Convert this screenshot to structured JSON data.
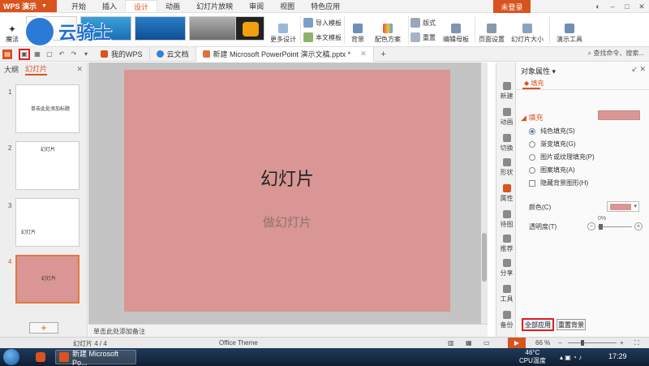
{
  "app": {
    "name": "WPS 演示",
    "login_label": "未登录",
    "accent": "#d9531e"
  },
  "menu_tabs": [
    "开始",
    "插入",
    "设计",
    "动画",
    "幻灯片放映",
    "审阅",
    "视图",
    "特色应用"
  ],
  "active_menu_tab": "设计",
  "ribbon": {
    "magic_label": "魔法",
    "more_design_label": "更多设计",
    "import_template_label": "导入模板",
    "this_doc_template_label": "本文模板",
    "background_label": "背景",
    "color_scheme_label": "配色方案",
    "layout_label": "版式",
    "reset_label": "重置",
    "edit_master_label": "编辑母板",
    "page_setup_label": "页面设置",
    "slide_size_label": "幻灯片大小",
    "presentation_tools_label": "演示工具"
  },
  "doc_tabs": [
    {
      "label": "我的WPS"
    },
    {
      "label": "云文档"
    },
    {
      "label": "新建 Microsoft PowerPoint 演示文稿.pptx *"
    }
  ],
  "search_placeholder": "查找命令、搜索...",
  "left_panel": {
    "tab_outline": "大纲",
    "tab_slides": "幻灯片",
    "slides": [
      {
        "num": "1",
        "text": "单击此处添加标题"
      },
      {
        "num": "2",
        "text": "幻灯片"
      },
      {
        "num": "3",
        "text": "幻灯片"
      },
      {
        "num": "4",
        "text": "幻灯片"
      }
    ]
  },
  "slide": {
    "title": "幻灯片",
    "subtitle": "做幻灯片",
    "background_color": "#d99694"
  },
  "notes_placeholder": "单击此处添加备注",
  "side_strip": [
    "新建",
    "动画",
    "切换",
    "形状",
    "属性",
    "待图",
    "推荐",
    "分享",
    "工具",
    "备份"
  ],
  "property_panel": {
    "title": "对象属性",
    "tab": "填充",
    "section": "填充",
    "options": [
      {
        "label": "纯色填充(S)",
        "checked": true
      },
      {
        "label": "渐变填充(G)",
        "checked": false
      },
      {
        "label": "图片或纹理填充(P)",
        "checked": false
      },
      {
        "label": "图案填充(A)",
        "checked": false
      }
    ],
    "hide_bg_label": "隐藏背景图形(H)",
    "color_label": "颜色(C)",
    "transparency_label": "透明度(T)",
    "transparency_value": "0%",
    "apply_all_label": "全部应用",
    "reset_bg_label": "重置背景"
  },
  "status": {
    "slide_count": "幻灯片 4 / 4",
    "theme": "Office Theme",
    "zoom": "66 %"
  },
  "taskbar": {
    "app_label": "新建 Microsoft Po...",
    "temp": "46°C",
    "temp_label": "CPU温度",
    "clock": "17:29"
  },
  "watermark_text": "云骑士"
}
